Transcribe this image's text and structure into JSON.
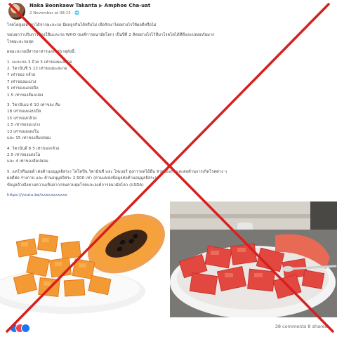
{
  "post": {
    "author": "Naka Boonkaew Takanta",
    "recipient_arrow": "▶",
    "recipient": "Amphoe Cha-uat",
    "meta": "2 November at 08:15 · 🌐",
    "lines": [
      "โรคไตสูงอย่าหาได้จากมะละกอ มีผลลูกกินได้หรือไม่ เพื่อรักษาไตอย่างไรให้ผลดีหรือไม่",
      "",
      "ขอบอกว่าปรับการต้องใช้มะละกอ WHO (องค์การอนามัยโลก) เป็นปีที่ 2 คิดอย่างไรไว้ที่มาโรคไตได้ที่ดีและปลอดภัยมาก",
      "โรคมะละกอสุด",
      "",
      "ผลมะละกอมีสารอาหารและแร่ธาตุดังนี้:",
      "",
      "1. มะละกอ 3 ถ้วย 3 เท่าของมะละกอ",
      "2. วิตามินซี 5 13 เท่าของมะละกอ",
      "7 เท่าของ กล้วย",
      "7 เท่าของมะม่วง",
      "5 เท่าของแอปเปิ้ล",
      "1.5 เท่าของส้มแปลง",
      "",
      "3. วิตามินเอ 6 10 เท่าของ ส้ม",
      "18 เท่าของแอปเปิ้ล",
      "15 เท่าของกล้วย",
      "1.5 เท่าของมะม่วง",
      "13 เท่าของแตงโม",
      "และ 15 เท่าของส้มปลอม",
      "",
      "4. วิตามินอี 8 5 เท่าของกล้วย",
      "2.5 เท่าของแตงโม",
      "และ 4 เท่าของส้มปลอม",
      "",
      "5. แคโรทีนอยด์ (ต่อต้านอนุมูลอิสระ) ไลโคปีน วิตามินซี และ ไฟเบอร์ สูงกว่าผลไม้อื่น ช่วยป้องกันและต่อต้านการเกิดโรคต่าง ๆ",
      "ผลดีต่อ ร่างกาย และ ต้านอนุมูลอิสระ 2,500 เท่า (ตามแหล่งข้อมูลต่อต้านอนุมูลอิสระ)",
      "ข้อมูลอ้างอิงตามความเห็นจากกรมควบคุมโรคและองค์การอนามัยโลก (USDA)",
      "",
      "https://youtu.be/xxxxxxxxxxx"
    ]
  },
  "footer": {
    "comments_shares": "38 comments  8 shares"
  }
}
